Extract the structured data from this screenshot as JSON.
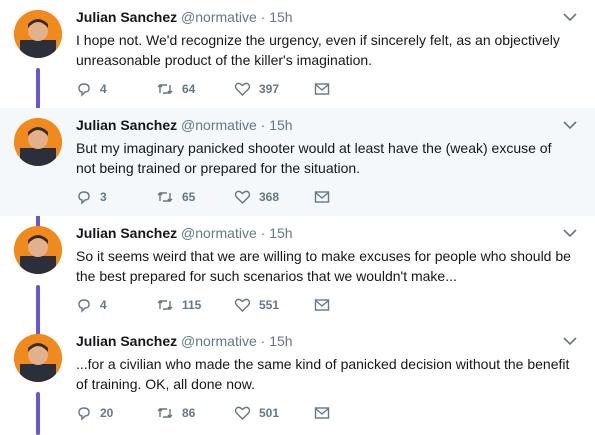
{
  "author": {
    "name": "Julian Sanchez",
    "handle": "@normative",
    "separator": "·"
  },
  "colors": {
    "thread_line": "#6b55d1",
    "avatar_bg": "#f08a1c",
    "meta": "#657786"
  },
  "tweets": [
    {
      "time": "15h",
      "text_lines": [
        "I hope not.  We'd recognize the urgency, even if sincerely felt, as an objectively",
        "unreasonable product of the killer's imagination."
      ],
      "replies": "4",
      "retweets": "64",
      "likes": "397"
    },
    {
      "time": "15h",
      "text_lines": [
        "But my imaginary panicked shooter would at least have the (weak) excuse of",
        "not being trained or prepared for the situation."
      ],
      "replies": "3",
      "retweets": "65",
      "likes": "368"
    },
    {
      "time": "15h",
      "text_lines": [
        "So it seems weird that we are willing to make excuses for people who should be",
        "the best prepared for such scenarios that we wouldn't make..."
      ],
      "replies": "4",
      "retweets": "115",
      "likes": "551"
    },
    {
      "time": "15h",
      "text_lines": [
        "...for a civilian who made the same kind of panicked decision without the benefit",
        "of training.  OK, all done now."
      ],
      "replies": "20",
      "retweets": "86",
      "likes": "501"
    }
  ]
}
